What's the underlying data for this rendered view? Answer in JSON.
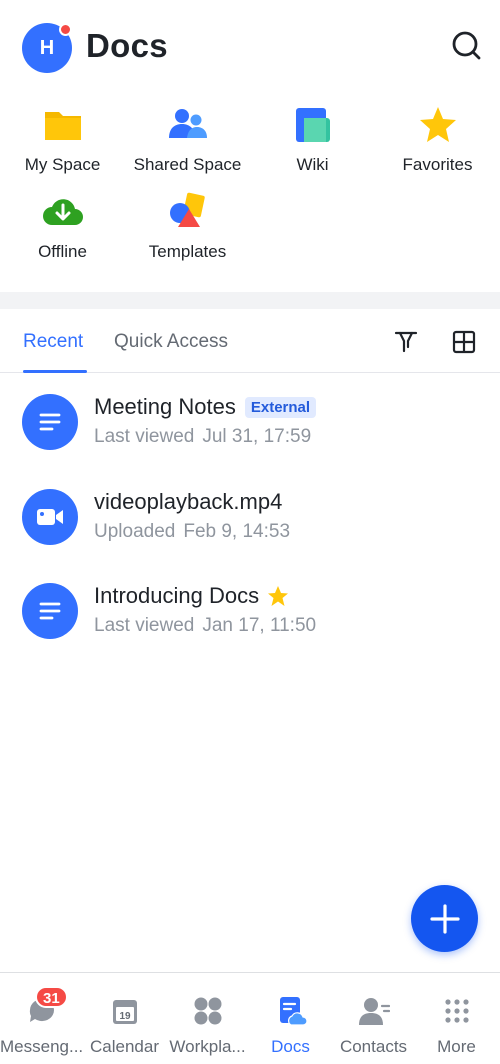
{
  "header": {
    "avatar_initial": "H",
    "title": "Docs"
  },
  "quick_grid": [
    {
      "label": "My Space",
      "icon": "folder-icon"
    },
    {
      "label": "Shared Space",
      "icon": "shared-people-icon"
    },
    {
      "label": "Wiki",
      "icon": "wiki-icon"
    },
    {
      "label": "Favorites",
      "icon": "star-icon"
    },
    {
      "label": "Offline",
      "icon": "cloud-download-icon"
    },
    {
      "label": "Templates",
      "icon": "templates-shapes-icon"
    }
  ],
  "tabs": {
    "recent": "Recent",
    "quick_access": "Quick Access"
  },
  "docs": [
    {
      "title": "Meeting Notes",
      "badge": "External",
      "meta_label": "Last viewed",
      "meta_time": "Jul 31, 17:59",
      "icon": "document-icon"
    },
    {
      "title": "videoplayback.mp4",
      "meta_label": "Uploaded",
      "meta_time": "Feb 9, 14:53",
      "icon": "video-icon"
    },
    {
      "title": "Introducing Docs",
      "starred": true,
      "meta_label": "Last viewed",
      "meta_time": "Jan 17, 11:50",
      "icon": "document-icon"
    }
  ],
  "bottom_nav": [
    {
      "label": "Messeng...",
      "badge": "31",
      "icon": "messenger-icon"
    },
    {
      "label": "Calendar",
      "icon": "calendar-icon",
      "calendar_day": "19"
    },
    {
      "label": "Workpla...",
      "icon": "workplace-icon"
    },
    {
      "label": "Docs",
      "icon": "docs-icon",
      "active": true
    },
    {
      "label": "Contacts",
      "icon": "contacts-icon"
    },
    {
      "label": "More",
      "icon": "more-grid-icon"
    }
  ],
  "colors": {
    "accent": "#3370ff",
    "badge_red": "#f54a45",
    "fab": "#1456f0"
  }
}
